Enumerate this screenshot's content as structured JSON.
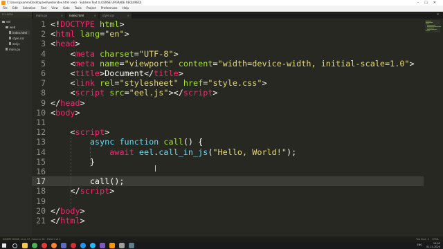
{
  "window": {
    "title": "C:\\Users\\psamm\\Desktop\\eel\\web\\index.html (eel) - Sublime Text (LICENSE UPGRADE REQUIRED)",
    "buttons": [
      "–",
      "□",
      "✕"
    ]
  },
  "menu": [
    "File",
    "Edit",
    "Selection",
    "Find",
    "View",
    "Goto",
    "Tools",
    "Project",
    "Preferences",
    "Help"
  ],
  "sidebar": {
    "header": "FOLDERS",
    "items": [
      {
        "label": "eel",
        "kind": "folder"
      },
      {
        "label": "web",
        "kind": "folder"
      },
      {
        "label": "index.html",
        "kind": "file",
        "selected": true
      },
      {
        "label": "style.css",
        "kind": "file"
      },
      {
        "label": "eel.js",
        "kind": "file"
      },
      {
        "label": "main.py",
        "kind": "file"
      }
    ]
  },
  "tabs": [
    {
      "label": "main.py",
      "active": false
    },
    {
      "label": "index.html",
      "active": true
    },
    {
      "label": "style.css",
      "active": false
    }
  ],
  "editor": {
    "current_line": 17,
    "lines": [
      {
        "n": "1",
        "tokens": [
          [
            "t-pl",
            "<!"
          ],
          [
            "t-tag",
            "DOCTYPE"
          ],
          [
            "t-pl",
            " "
          ],
          [
            "t-attr",
            "html"
          ],
          [
            "t-pl",
            ">"
          ]
        ]
      },
      {
        "n": "2",
        "tokens": [
          [
            "t-pl",
            "<"
          ],
          [
            "t-tag",
            "html"
          ],
          [
            "t-pl",
            " "
          ],
          [
            "t-attr",
            "lang"
          ],
          [
            "t-pl",
            "="
          ],
          [
            "t-str",
            "\"en\""
          ],
          [
            "t-pl",
            ">"
          ]
        ]
      },
      {
        "n": "3",
        "tokens": [
          [
            "t-pl",
            "<"
          ],
          [
            "t-tag",
            "head"
          ],
          [
            "t-pl",
            ">"
          ]
        ]
      },
      {
        "n": "4",
        "tokens": [
          [
            "t-pl",
            "    <"
          ],
          [
            "t-tag",
            "meta"
          ],
          [
            "t-pl",
            " "
          ],
          [
            "t-attr",
            "charset"
          ],
          [
            "t-pl",
            "="
          ],
          [
            "t-str",
            "\"UTF-8\""
          ],
          [
            "t-pl",
            ">"
          ]
        ]
      },
      {
        "n": "5",
        "tokens": [
          [
            "t-pl",
            "    <"
          ],
          [
            "t-tag",
            "meta"
          ],
          [
            "t-pl",
            " "
          ],
          [
            "t-attr",
            "name"
          ],
          [
            "t-pl",
            "="
          ],
          [
            "t-str",
            "\"viewport\""
          ],
          [
            "t-pl",
            " "
          ],
          [
            "t-attr",
            "content"
          ],
          [
            "t-pl",
            "="
          ],
          [
            "t-str",
            "\"width=device-width, initial-scale=1.0\""
          ],
          [
            "t-pl",
            ">"
          ]
        ]
      },
      {
        "n": "6",
        "tokens": [
          [
            "t-pl",
            "    <"
          ],
          [
            "t-tag",
            "title"
          ],
          [
            "t-pl",
            ">Document</"
          ],
          [
            "t-tag",
            "title"
          ],
          [
            "t-pl",
            ">"
          ]
        ]
      },
      {
        "n": "7",
        "tokens": [
          [
            "t-pl",
            "    <"
          ],
          [
            "t-tag",
            "link"
          ],
          [
            "t-pl",
            " "
          ],
          [
            "t-attr",
            "rel"
          ],
          [
            "t-pl",
            "="
          ],
          [
            "t-str",
            "\"stylesheet\""
          ],
          [
            "t-pl",
            " "
          ],
          [
            "t-attr",
            "href"
          ],
          [
            "t-pl",
            "="
          ],
          [
            "t-str",
            "\"style.css\""
          ],
          [
            "t-pl",
            ">"
          ]
        ]
      },
      {
        "n": "8",
        "tokens": [
          [
            "t-pl",
            "    <"
          ],
          [
            "t-tag",
            "script"
          ],
          [
            "t-pl",
            " "
          ],
          [
            "t-attr",
            "src"
          ],
          [
            "t-pl",
            "="
          ],
          [
            "t-str",
            "\"eel.js\""
          ],
          [
            "t-pl",
            "></"
          ],
          [
            "t-tag",
            "script"
          ],
          [
            "t-pl",
            ">"
          ]
        ]
      },
      {
        "n": "9",
        "tokens": [
          [
            "t-pl",
            "</"
          ],
          [
            "t-tag",
            "head"
          ],
          [
            "t-pl",
            ">"
          ]
        ]
      },
      {
        "n": "10",
        "tokens": [
          [
            "t-pl",
            "<"
          ],
          [
            "t-tag",
            "body"
          ],
          [
            "t-pl",
            ">"
          ]
        ]
      },
      {
        "n": "11",
        "tokens": []
      },
      {
        "n": "12",
        "tokens": [
          [
            "t-pl",
            "    <"
          ],
          [
            "t-tag",
            "script"
          ],
          [
            "t-pl",
            ">"
          ]
        ]
      },
      {
        "n": "13",
        "tokens": [
          [
            "t-pl",
            "        "
          ],
          [
            "t-kw",
            "async"
          ],
          [
            "t-pl",
            " "
          ],
          [
            "t-kw",
            "function"
          ],
          [
            "t-pl",
            " "
          ],
          [
            "t-fn",
            "call"
          ],
          [
            "t-pl",
            "() {"
          ]
        ]
      },
      {
        "n": "14",
        "tokens": [
          [
            "t-pl",
            "            "
          ],
          [
            "t-tag",
            "await"
          ],
          [
            "t-pl",
            " "
          ],
          [
            "t-kw",
            "eel"
          ],
          [
            "t-pl",
            "."
          ],
          [
            "t-kw",
            "call_in_js"
          ],
          [
            "t-pl",
            "("
          ],
          [
            "t-str",
            "\"Hello, World!\""
          ],
          [
            "t-pl",
            ");"
          ]
        ]
      },
      {
        "n": "15",
        "tokens": [
          [
            "t-pl",
            "        }"
          ]
        ]
      },
      {
        "n": "16",
        "tokens": []
      },
      {
        "n": "17",
        "tokens": [
          [
            "t-pl",
            "        call();"
          ]
        ]
      },
      {
        "n": "18",
        "tokens": [
          [
            "t-pl",
            "    </"
          ],
          [
            "t-tag",
            "script"
          ],
          [
            "t-pl",
            ">"
          ]
        ]
      },
      {
        "n": "19",
        "tokens": []
      },
      {
        "n": "20",
        "tokens": [
          [
            "t-pl",
            "</"
          ],
          [
            "t-tag",
            "body"
          ],
          [
            "t-pl",
            ">"
          ]
        ]
      },
      {
        "n": "21",
        "tokens": [
          [
            "t-pl",
            "</"
          ],
          [
            "t-tag",
            "html"
          ],
          [
            "t-pl",
            ">"
          ]
        ]
      }
    ]
  },
  "status": {
    "left": "INSERT MODE, Line 17, Column 16 - Field 1 of 1",
    "tab_size": "Tab Size: 4",
    "syntax": "HTML"
  },
  "taskbar": {
    "lang": "ENG",
    "time": "19:02",
    "date": "01.11.2020",
    "icons": [
      {
        "name": "windows-start-icon",
        "color": "#e8e8e8"
      },
      {
        "name": "search-icon",
        "color": "#cfcfcf"
      },
      {
        "name": "file-explorer-icon",
        "color": "#f2c744"
      },
      {
        "name": "chrome-icon",
        "color": "#4caf50"
      },
      {
        "name": "opera-icon",
        "color": "#e53935"
      },
      {
        "name": "firefox-icon",
        "color": "#ff7f2a"
      },
      {
        "name": "app-icon",
        "color": "#5c6bc0"
      },
      {
        "name": "record-icon",
        "color": "#d32f2f"
      },
      {
        "name": "edge-icon",
        "color": "#2196f3"
      },
      {
        "name": "telegram-icon",
        "color": "#29b6f6"
      },
      {
        "name": "app-icon",
        "color": "#7e57c2"
      },
      {
        "name": "sublime-icon",
        "color": "#ff9800"
      },
      {
        "name": "app-icon",
        "color": "#9e9e9e"
      },
      {
        "name": "camera-icon",
        "color": "#607d8b"
      }
    ]
  }
}
